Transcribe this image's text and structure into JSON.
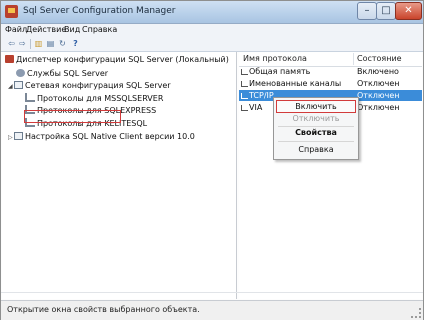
{
  "window": {
    "title": "Sql Server Configuration Manager"
  },
  "menu": [
    "Файл",
    "Действие",
    "Вид",
    "Справка"
  ],
  "toolbar": {
    "back": "⇦",
    "forward": "⇨",
    "up": "▥",
    "props": "▤",
    "refresh": "↻",
    "help": "?"
  },
  "tree": [
    "Диспетчер конфигурации SQL Server (Локальный)",
    "Службы SQL Server",
    "Сетевая конфигурация SQL Server",
    "Протоколы для MSSQLSERVER",
    "Протоколы для SQLEXPRESS",
    "Протоколы для KELITESQL",
    "Настройка SQL Native Client версии 10.0"
  ],
  "list": {
    "headers": {
      "name": "Имя протокола",
      "state": "Состояние"
    },
    "rows": [
      {
        "name": "Общая память",
        "state": "Включено"
      },
      {
        "name": "Именованные каналы",
        "state": "Отключен"
      },
      {
        "name": "TCP/IP",
        "state": "Отключен"
      },
      {
        "name": "VIA",
        "state": "Отключен"
      }
    ]
  },
  "context_menu": {
    "enable": "Включить",
    "disable": "Отключить",
    "properties": "Свойства",
    "help": "Справка"
  },
  "status": "Открытие окна свойств выбранного объекта."
}
